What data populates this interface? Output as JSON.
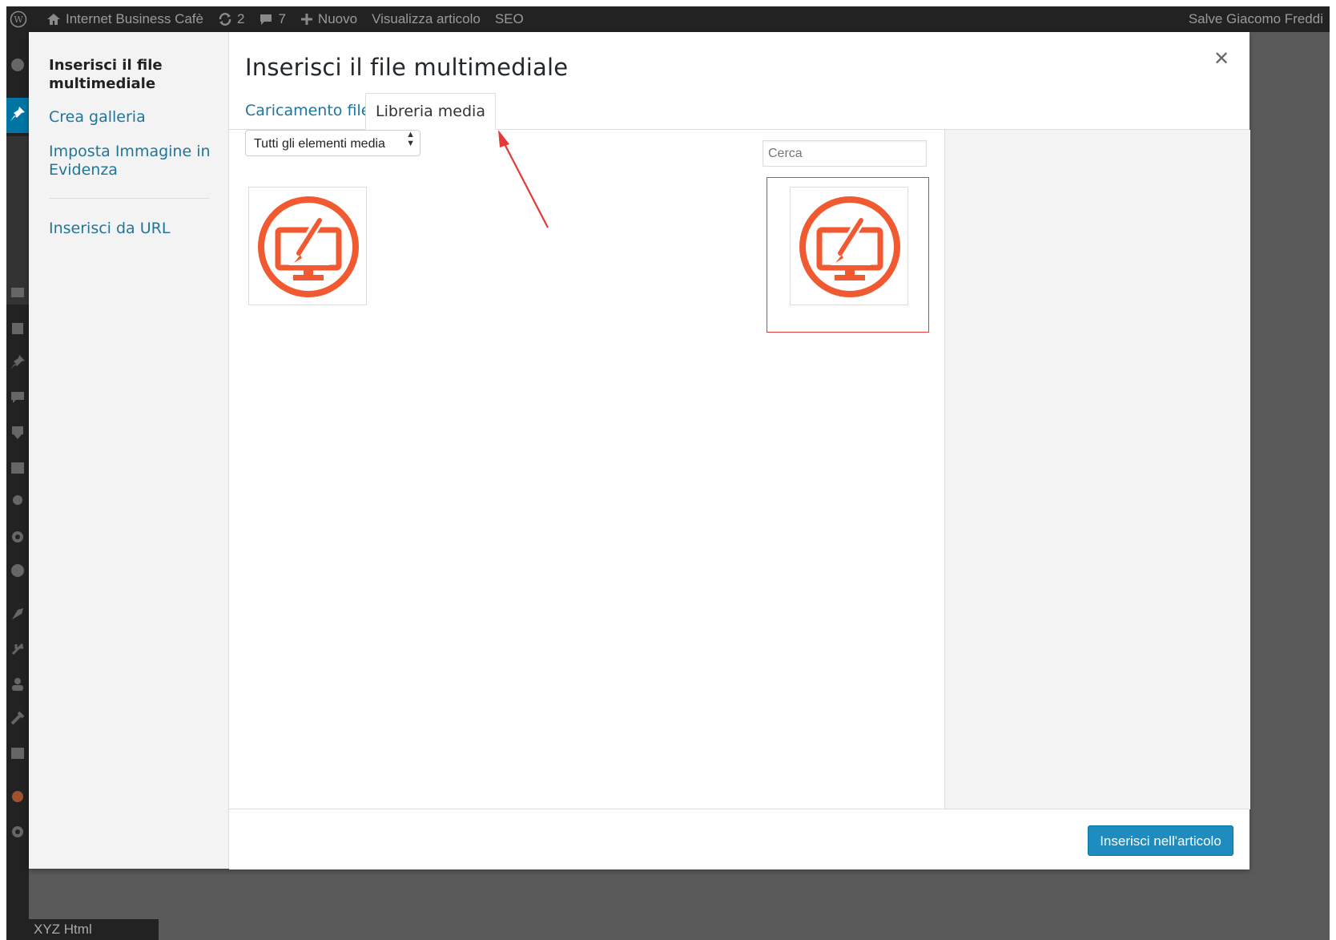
{
  "adminbar": {
    "site_name": "Internet Business Cafè",
    "updates_count": "2",
    "comments_count": "7",
    "new_label": "Nuovo",
    "view_post_label": "Visualizza articolo",
    "seo_label": "SEO",
    "greeting": "Salve Giacomo Freddi"
  },
  "bottombar": {
    "label": "XYZ Html"
  },
  "modal": {
    "title": "Inserisci il file multimediale",
    "close_icon": "close-icon",
    "menu": {
      "items": [
        {
          "label": "Inserisci il file multimediale"
        },
        {
          "label": "Crea galleria"
        },
        {
          "label": "Imposta Immagine in Evidenza"
        },
        {
          "label": "Inserisci da URL"
        }
      ]
    },
    "tabs": [
      {
        "label": "Caricamento file"
      },
      {
        "label": "Libreria media"
      }
    ],
    "filter": {
      "selected": "Tutti gli elementi media"
    },
    "search": {
      "placeholder": "Cerca"
    },
    "insert_button": "Inserisci nell'articolo"
  },
  "colors": {
    "accent": "#1e8cbe",
    "link": "#21759b",
    "icon_orange": "#f15a31",
    "annotation_red": "#e53935"
  }
}
